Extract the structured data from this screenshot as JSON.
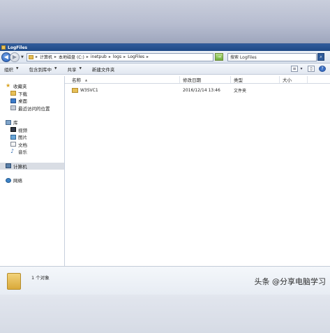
{
  "window": {
    "title": "LogFiles"
  },
  "address": {
    "crumbs": [
      "计算机",
      "本地磁盘 (C:)",
      "inetpub",
      "logs",
      "LogFiles"
    ],
    "separator": "▸",
    "go_symbol": "→"
  },
  "search": {
    "placeholder": "搜索 LogFiles"
  },
  "toolbar": {
    "organize": "组织",
    "include_in_library": "包含到库中",
    "share": "共享",
    "new_folder": "新建文件夹"
  },
  "navpane": {
    "favorites": {
      "label": "收藏夹",
      "items": [
        "下载",
        "桌面",
        "最近访问的位置"
      ]
    },
    "libraries": {
      "label": "库",
      "items": [
        "视频",
        "图片",
        "文档",
        "音乐"
      ]
    },
    "computer": "计算机",
    "network": "网络"
  },
  "columns": {
    "name": "名称",
    "date": "修改日期",
    "type": "类型",
    "size": "大小"
  },
  "files": [
    {
      "name": "W3SVC1",
      "date": "2016/12/14 13:46",
      "type": "文件夹",
      "size": ""
    }
  ],
  "status": {
    "text": "1 个对象"
  },
  "watermark": "头条 @分享电脑学习"
}
